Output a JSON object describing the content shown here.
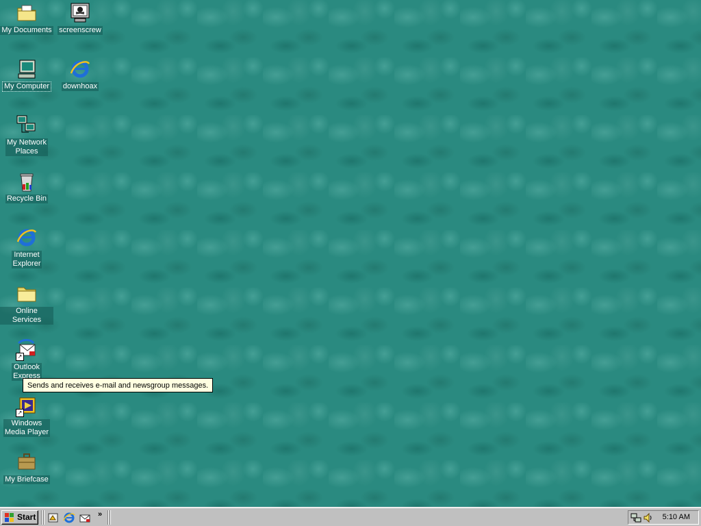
{
  "desktop": {
    "background_color": "#2a8a80",
    "icons": [
      {
        "label": "My Documents",
        "icon": "folder-documents-icon"
      },
      {
        "label": "screenscrew",
        "icon": "computer-pirate-icon"
      },
      {
        "label": "My Computer",
        "icon": "my-computer-icon",
        "selected": true
      },
      {
        "label": "downhoax",
        "icon": "internet-explorer-icon"
      },
      {
        "label": "My Network\nPlaces",
        "icon": "network-places-icon"
      },
      {
        "label": "Recycle Bin",
        "icon": "recycle-bin-icon"
      },
      {
        "label": "Internet\nExplorer",
        "icon": "internet-explorer-icon"
      },
      {
        "label": "Online Services",
        "icon": "folder-icon"
      },
      {
        "label": "Outlook\nExpress",
        "icon": "outlook-express-icon"
      },
      {
        "label": "Windows\nMedia Player",
        "icon": "media-player-icon"
      },
      {
        "label": "My Briefcase",
        "icon": "briefcase-icon"
      }
    ]
  },
  "tooltip": {
    "text": "Sends and receives e-mail and newsgroup messages."
  },
  "taskbar": {
    "start_label": "Start",
    "quick_launch": [
      {
        "icon": "show-desktop-icon"
      },
      {
        "icon": "internet-explorer-icon"
      },
      {
        "icon": "outlook-express-icon"
      }
    ],
    "chevron": "»",
    "tray": {
      "icons": [
        "network-icon",
        "volume-icon"
      ],
      "clock": "5:10 AM"
    }
  }
}
